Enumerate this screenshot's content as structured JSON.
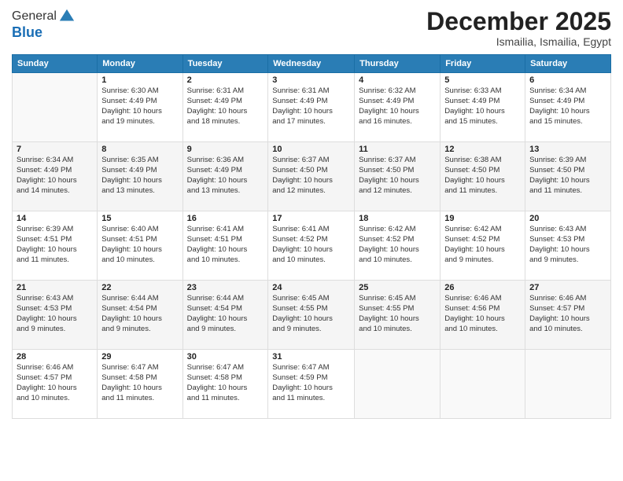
{
  "logo": {
    "general": "General",
    "blue": "Blue"
  },
  "header": {
    "month": "December 2025",
    "location": "Ismailia, Ismailia, Egypt"
  },
  "days_of_week": [
    "Sunday",
    "Monday",
    "Tuesday",
    "Wednesday",
    "Thursday",
    "Friday",
    "Saturday"
  ],
  "weeks": [
    [
      {
        "day": "",
        "info": ""
      },
      {
        "day": "1",
        "info": "Sunrise: 6:30 AM\nSunset: 4:49 PM\nDaylight: 10 hours\nand 19 minutes."
      },
      {
        "day": "2",
        "info": "Sunrise: 6:31 AM\nSunset: 4:49 PM\nDaylight: 10 hours\nand 18 minutes."
      },
      {
        "day": "3",
        "info": "Sunrise: 6:31 AM\nSunset: 4:49 PM\nDaylight: 10 hours\nand 17 minutes."
      },
      {
        "day": "4",
        "info": "Sunrise: 6:32 AM\nSunset: 4:49 PM\nDaylight: 10 hours\nand 16 minutes."
      },
      {
        "day": "5",
        "info": "Sunrise: 6:33 AM\nSunset: 4:49 PM\nDaylight: 10 hours\nand 15 minutes."
      },
      {
        "day": "6",
        "info": "Sunrise: 6:34 AM\nSunset: 4:49 PM\nDaylight: 10 hours\nand 15 minutes."
      }
    ],
    [
      {
        "day": "7",
        "info": "Sunrise: 6:34 AM\nSunset: 4:49 PM\nDaylight: 10 hours\nand 14 minutes."
      },
      {
        "day": "8",
        "info": "Sunrise: 6:35 AM\nSunset: 4:49 PM\nDaylight: 10 hours\nand 13 minutes."
      },
      {
        "day": "9",
        "info": "Sunrise: 6:36 AM\nSunset: 4:49 PM\nDaylight: 10 hours\nand 13 minutes."
      },
      {
        "day": "10",
        "info": "Sunrise: 6:37 AM\nSunset: 4:50 PM\nDaylight: 10 hours\nand 12 minutes."
      },
      {
        "day": "11",
        "info": "Sunrise: 6:37 AM\nSunset: 4:50 PM\nDaylight: 10 hours\nand 12 minutes."
      },
      {
        "day": "12",
        "info": "Sunrise: 6:38 AM\nSunset: 4:50 PM\nDaylight: 10 hours\nand 11 minutes."
      },
      {
        "day": "13",
        "info": "Sunrise: 6:39 AM\nSunset: 4:50 PM\nDaylight: 10 hours\nand 11 minutes."
      }
    ],
    [
      {
        "day": "14",
        "info": "Sunrise: 6:39 AM\nSunset: 4:51 PM\nDaylight: 10 hours\nand 11 minutes."
      },
      {
        "day": "15",
        "info": "Sunrise: 6:40 AM\nSunset: 4:51 PM\nDaylight: 10 hours\nand 10 minutes."
      },
      {
        "day": "16",
        "info": "Sunrise: 6:41 AM\nSunset: 4:51 PM\nDaylight: 10 hours\nand 10 minutes."
      },
      {
        "day": "17",
        "info": "Sunrise: 6:41 AM\nSunset: 4:52 PM\nDaylight: 10 hours\nand 10 minutes."
      },
      {
        "day": "18",
        "info": "Sunrise: 6:42 AM\nSunset: 4:52 PM\nDaylight: 10 hours\nand 10 minutes."
      },
      {
        "day": "19",
        "info": "Sunrise: 6:42 AM\nSunset: 4:52 PM\nDaylight: 10 hours\nand 9 minutes."
      },
      {
        "day": "20",
        "info": "Sunrise: 6:43 AM\nSunset: 4:53 PM\nDaylight: 10 hours\nand 9 minutes."
      }
    ],
    [
      {
        "day": "21",
        "info": "Sunrise: 6:43 AM\nSunset: 4:53 PM\nDaylight: 10 hours\nand 9 minutes."
      },
      {
        "day": "22",
        "info": "Sunrise: 6:44 AM\nSunset: 4:54 PM\nDaylight: 10 hours\nand 9 minutes."
      },
      {
        "day": "23",
        "info": "Sunrise: 6:44 AM\nSunset: 4:54 PM\nDaylight: 10 hours\nand 9 minutes."
      },
      {
        "day": "24",
        "info": "Sunrise: 6:45 AM\nSunset: 4:55 PM\nDaylight: 10 hours\nand 9 minutes."
      },
      {
        "day": "25",
        "info": "Sunrise: 6:45 AM\nSunset: 4:55 PM\nDaylight: 10 hours\nand 10 minutes."
      },
      {
        "day": "26",
        "info": "Sunrise: 6:46 AM\nSunset: 4:56 PM\nDaylight: 10 hours\nand 10 minutes."
      },
      {
        "day": "27",
        "info": "Sunrise: 6:46 AM\nSunset: 4:57 PM\nDaylight: 10 hours\nand 10 minutes."
      }
    ],
    [
      {
        "day": "28",
        "info": "Sunrise: 6:46 AM\nSunset: 4:57 PM\nDaylight: 10 hours\nand 10 minutes."
      },
      {
        "day": "29",
        "info": "Sunrise: 6:47 AM\nSunset: 4:58 PM\nDaylight: 10 hours\nand 11 minutes."
      },
      {
        "day": "30",
        "info": "Sunrise: 6:47 AM\nSunset: 4:58 PM\nDaylight: 10 hours\nand 11 minutes."
      },
      {
        "day": "31",
        "info": "Sunrise: 6:47 AM\nSunset: 4:59 PM\nDaylight: 10 hours\nand 11 minutes."
      },
      {
        "day": "",
        "info": ""
      },
      {
        "day": "",
        "info": ""
      },
      {
        "day": "",
        "info": ""
      }
    ]
  ]
}
